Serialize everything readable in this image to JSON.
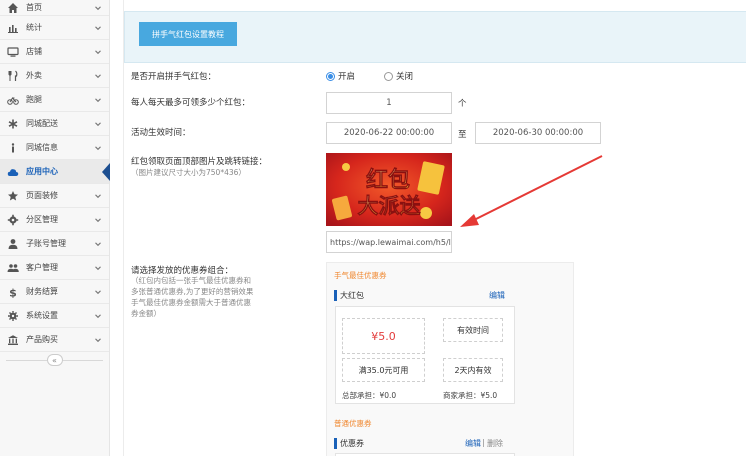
{
  "sidebar": {
    "items": [
      {
        "label": "首页",
        "icon": "home-icon"
      },
      {
        "label": "统计",
        "icon": "bar-chart-icon"
      },
      {
        "label": "店铺",
        "icon": "monitor-icon"
      },
      {
        "label": "外卖",
        "icon": "fork-knife-icon"
      },
      {
        "label": "跑腿",
        "icon": "bicycle-icon"
      },
      {
        "label": "同城配送",
        "icon": "asterisk-icon"
      },
      {
        "label": "同城信息",
        "icon": "info-icon"
      },
      {
        "label": "应用中心",
        "icon": "cloud-icon"
      },
      {
        "label": "页面装修",
        "icon": "star-icon"
      },
      {
        "label": "分区管理",
        "icon": "gear-icon"
      },
      {
        "label": "子账号管理",
        "icon": "user-icon"
      },
      {
        "label": "客户管理",
        "icon": "users-icon"
      },
      {
        "label": "财务结算",
        "icon": "dollar-icon"
      },
      {
        "label": "系统设置",
        "icon": "cog-icon"
      },
      {
        "label": "产品购买",
        "icon": "bank-icon"
      }
    ],
    "active_index": 7,
    "collapse_glyph": "«"
  },
  "main": {
    "tutorial_button": "拼手气红包设置教程",
    "enable": {
      "label": "是否开启拼手气红包：",
      "options": [
        "开启",
        "关闭"
      ],
      "selected": 0
    },
    "daily_limit": {
      "label": "每人每天最多可领多少个红包：",
      "value": "1",
      "unit": "个"
    },
    "active_time": {
      "label": "活动生效时间：",
      "start": "2020-06-22 00:00:00",
      "separator": "至",
      "end": "2020-06-30 00:00:00"
    },
    "banner": {
      "label": "红包领取页面顶部图片及跳转链接：",
      "hint": "（图片建议尺寸大小为750*436）",
      "image_text_top": "红包",
      "image_text_bottom": "大派送",
      "link": "https://wap.lewaimai.com/h5/l"
    },
    "coupon_combo": {
      "label": "请选择发放的优惠券组合：",
      "hint_lines": [
        "（红包内包括一张手气最佳优惠券和",
        "多张普通优惠券,为了更好的营销效果",
        "手气最佳优惠券金额需大于普通优惠",
        "券金额）"
      ],
      "best": {
        "section_title": "手气最佳优惠券",
        "name": "大红包",
        "edit": "编辑",
        "amount": "¥5.0",
        "condition": "满35.0元可用",
        "validity_label": "有效时间",
        "validity_value": "2天内有效",
        "hq_share": "总部承担：¥0.0",
        "merchant_share": "商家承担：¥5.0"
      },
      "normal": {
        "section_title": "普通优惠券",
        "name": "优惠券",
        "edit": "编辑",
        "divider": "|",
        "delete": "删除"
      }
    }
  },
  "colors": {
    "accent": "#1a61b8",
    "button": "#48a8df",
    "price": "#e33d3d",
    "section_title": "#f0862d",
    "annotation_arrow": "#e53935"
  }
}
